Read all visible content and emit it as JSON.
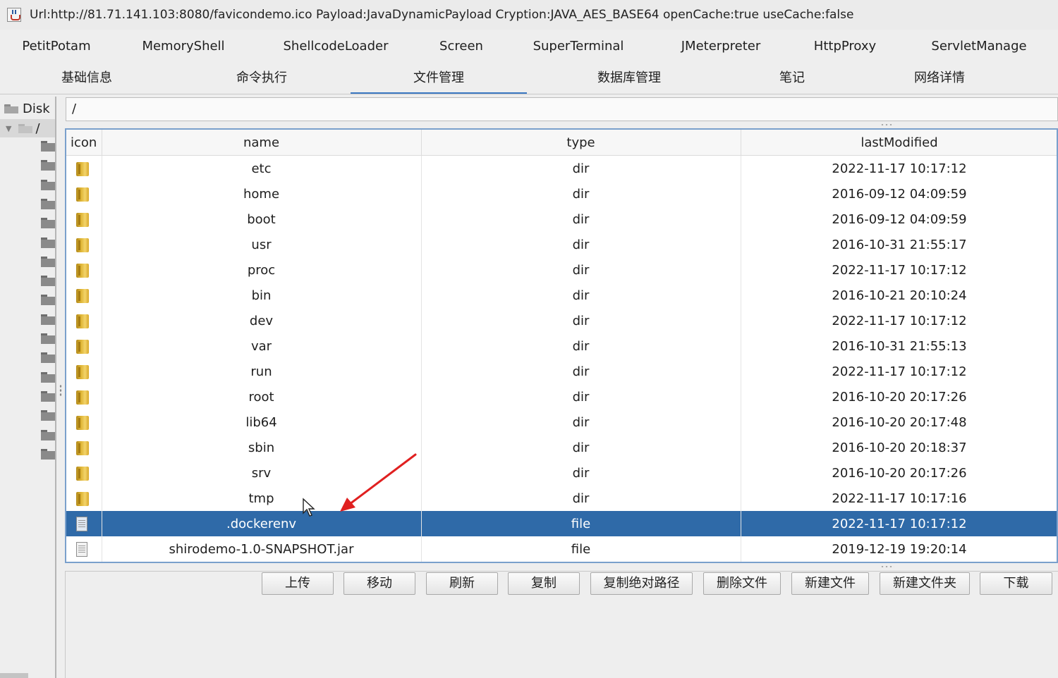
{
  "window": {
    "title": "Url:http://81.71.141.103:8080/favicondemo.ico Payload:JavaDynamicPayload Cryption:JAVA_AES_BASE64 openCache:true useCache:false",
    "icon": "java-app-icon"
  },
  "top_tabs": [
    {
      "label": "PetitPotam"
    },
    {
      "label": "MemoryShell"
    },
    {
      "label": "ShellcodeLoader"
    },
    {
      "label": "Screen"
    },
    {
      "label": "SuperTerminal"
    },
    {
      "label": "JMeterpreter"
    },
    {
      "label": "HttpProxy"
    },
    {
      "label": "ServletManage"
    }
  ],
  "sub_tabs": [
    {
      "label": "基础信息",
      "active": false
    },
    {
      "label": "命令执行",
      "active": false
    },
    {
      "label": "文件管理",
      "active": true
    },
    {
      "label": "数据库管理",
      "active": false
    },
    {
      "label": "笔记",
      "active": false
    },
    {
      "label": "网络详情",
      "active": false
    }
  ],
  "tree": {
    "disk_label": "Disk",
    "root_label": "/",
    "child_folder_count": 17
  },
  "path": {
    "value": "/"
  },
  "table": {
    "columns": [
      "icon",
      "name",
      "type",
      "lastModified"
    ],
    "rows": [
      {
        "icon": "folder",
        "name": "etc",
        "type": "dir",
        "lastModified": "2022-11-17 10:17:12"
      },
      {
        "icon": "folder",
        "name": "home",
        "type": "dir",
        "lastModified": "2016-09-12 04:09:59"
      },
      {
        "icon": "folder",
        "name": "boot",
        "type": "dir",
        "lastModified": "2016-09-12 04:09:59"
      },
      {
        "icon": "folder",
        "name": "usr",
        "type": "dir",
        "lastModified": "2016-10-31 21:55:17"
      },
      {
        "icon": "folder",
        "name": "proc",
        "type": "dir",
        "lastModified": "2022-11-17 10:17:12"
      },
      {
        "icon": "folder",
        "name": "bin",
        "type": "dir",
        "lastModified": "2016-10-21 20:10:24"
      },
      {
        "icon": "folder",
        "name": "dev",
        "type": "dir",
        "lastModified": "2022-11-17 10:17:12"
      },
      {
        "icon": "folder",
        "name": "var",
        "type": "dir",
        "lastModified": "2016-10-31 21:55:13"
      },
      {
        "icon": "folder",
        "name": "run",
        "type": "dir",
        "lastModified": "2022-11-17 10:17:12"
      },
      {
        "icon": "folder",
        "name": "root",
        "type": "dir",
        "lastModified": "2016-10-20 20:17:26"
      },
      {
        "icon": "folder",
        "name": "lib64",
        "type": "dir",
        "lastModified": "2016-10-20 20:17:48"
      },
      {
        "icon": "folder",
        "name": "sbin",
        "type": "dir",
        "lastModified": "2016-10-20 20:18:37"
      },
      {
        "icon": "folder",
        "name": "srv",
        "type": "dir",
        "lastModified": "2016-10-20 20:17:26"
      },
      {
        "icon": "folder",
        "name": "tmp",
        "type": "dir",
        "lastModified": "2022-11-17 10:17:16"
      },
      {
        "icon": "file",
        "name": ".dockerenv",
        "type": "file",
        "lastModified": "2022-11-17 10:17:12",
        "selected": true
      },
      {
        "icon": "file",
        "name": "shirodemo-1.0-SNAPSHOT.jar",
        "type": "file",
        "lastModified": "2019-12-19 19:20:14"
      }
    ]
  },
  "buttons": [
    {
      "label": "上传"
    },
    {
      "label": "移动"
    },
    {
      "label": "刷新"
    },
    {
      "label": "复制"
    },
    {
      "label": "复制绝对路径"
    },
    {
      "label": "删除文件"
    },
    {
      "label": "新建文件"
    },
    {
      "label": "新建文件夹"
    },
    {
      "label": "下载"
    }
  ],
  "colors": {
    "selection": "#2f6aa8",
    "active_tab_underline": "#3a78c2",
    "annotation_arrow": "#e02020",
    "folder_icon": "#e0b637"
  }
}
